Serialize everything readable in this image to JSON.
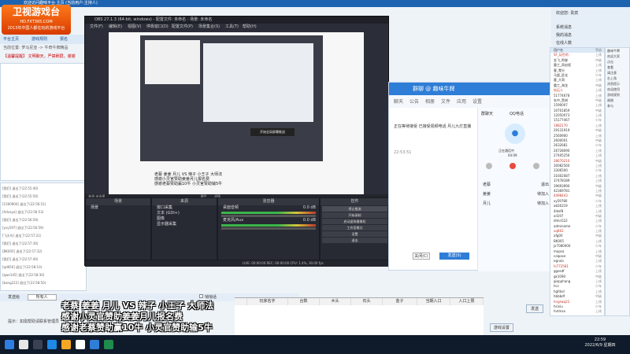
{
  "app": {
    "titlebar": "欢迎访问趣味平台·主页 (当前用户:主持人)",
    "logo_line1": "卫视游戏台",
    "logo_line2": "HD.FXT365.COM",
    "logo_line3": "2013年中国人都在玩的游戏平台",
    "topbar": [
      "平台主页",
      "游戏规则",
      "报名"
    ],
    "breadcrumb": "当前位置: 罗马尼亚 -> 牛奇牛牌精品",
    "notice": "【温馨提醒】 文明聊天，严禁刷屏，谢谢",
    "chatlog": [
      "[我们] 退出了(22:55:40)",
      "[我们] 退出了(22:55:50)",
      "[1560900] 退出了(22:56:51)",
      "[Advaya] 退出了(22:56:53)",
      "[我们] 退出了(22:56:59)",
      "[yxy597] 退出了(22:56:59)",
      "[飞天鸟] 退出了(22:57:21)",
      "[我们] 退出了(22:57:30)",
      "[BK005] 退出了(22:57:32)",
      "[我们] 退出了(22:57:40)",
      "[qd656] 退出了(22:58:10)",
      "[qwe145] 退出了(22:58:30)",
      "[bang222] 退出了(22:58:50)"
    ],
    "send_label": "发送给",
    "send_target": "所有人",
    "checkbox_label": "悄悄话",
    "tips": "提示：如需帮助请联系管理员",
    "send_button": "发送",
    "settings_button": "游戏设置"
  },
  "obs": {
    "title": "OBS 27.1.3 (64-bit, windows) - 配置文件: 未命名 - 场景: 未命名",
    "menu": [
      "文件(F)",
      "编辑(E)",
      "视图(V)",
      "停靠窗口(D)",
      "配置文件(P)",
      "场景集合(S)",
      "工具(T)",
      "帮助(H)"
    ],
    "popup": "开始全局屏幕推送",
    "caption_line1": "老蔡 姜姜 月儿 VS 辣子 小王子 大师法",
    "caption_line2": "感谢小灵官赞助姜姜月儿报名费",
    "caption_line3": "感谢老蔡赞助赢10牛 小灵官赞助输5牛",
    "source_panel_title": "来源 未选择",
    "filter_btn": "属性",
    "filter_btn2": "滤镜",
    "docks": {
      "scenes_title": "场景",
      "scenes": [
        "场景"
      ],
      "sources_title": "来源",
      "sources": [
        "窗口采集",
        "文本 (GDI+)",
        "图像",
        "显示器采集"
      ],
      "mixer_title": "混音器",
      "mixer": [
        {
          "name": "桌面音频",
          "db": "0.0 dB"
        },
        {
          "name": "麦克风/Aux",
          "db": "0.0 dB"
        }
      ],
      "transitions_title": "转场特效",
      "controls_title": "控件",
      "controls": [
        "停止推流",
        "开始录制",
        "启动虚拟摄像机",
        "工作室模式",
        "设置",
        "退出"
      ],
      "transition_name": "渐变"
    },
    "status": "LIVE: 00:00:00  REC: 00:00:00  CPU: 1.4%, 30.00 fps"
  },
  "qq": {
    "title": "群聊 @ 趣味牛牌",
    "tabs": [
      "聊天",
      "公告",
      "相册",
      "文件",
      "应用",
      "设置"
    ],
    "msg1": "正在等待接受 已接受视频电话 月儿九灯直播",
    "time": "22:53:51",
    "side_title": "群聊天",
    "side_sub": "QQ电话",
    "side_btn": "正在通话中",
    "side_dur": "04:09",
    "members": [
      {
        "name": "老蔡",
        "tag": "退出"
      },
      {
        "name": "姜姜",
        "tag": "待加入"
      },
      {
        "name": "月儿",
        "tag": "待加入"
      }
    ],
    "btn_close": "关闭(C)",
    "btn_send": "发送(S)"
  },
  "sidenav": {
    "welcome": "欢迎您: 贵宾",
    "items": [
      "系统消息",
      "我的消息",
      "在线人数"
    ]
  },
  "members_header": [
    "用户名",
    "等级"
  ],
  "members": [
    {
      "name": "SF_玩世的",
      "tag": "上线"
    },
    {
      "name": "金飞_鸣誉",
      "tag": "中级"
    },
    {
      "name": "重工_再启程",
      "tag": "上线"
    },
    {
      "name": "客_零分",
      "tag": "上线"
    },
    {
      "name": "马超_匠化",
      "tag": "少年"
    },
    {
      "name": "客_大哥",
      "tag": "上线"
    },
    {
      "name": "重工_海龙",
      "tag": "中级"
    },
    {
      "name": "钻石人",
      "tag": "上线"
    },
    {
      "name": "51774678",
      "tag": "上线"
    },
    {
      "name": "玄中_黑胡",
      "tag": "中级"
    },
    {
      "name": "1590007",
      "tag": "上线"
    },
    {
      "name": "10701859",
      "tag": "中级"
    },
    {
      "name": "12050073",
      "tag": "上线"
    },
    {
      "name": "15177467",
      "tag": "少年"
    },
    {
      "name": "1882170",
      "tag": "上线"
    },
    {
      "name": "29131919",
      "tag": "中级"
    },
    {
      "name": "2560900",
      "tag": "上线"
    },
    {
      "name": "2600001",
      "tag": "中级"
    },
    {
      "name": "2632681",
      "tag": "少年"
    },
    {
      "name": "26728090",
      "tag": "上线"
    },
    {
      "name": "27405256",
      "tag": "上线"
    },
    {
      "name": "28670210",
      "tag": "中级"
    },
    {
      "name": "30082560",
      "tag": "上线"
    },
    {
      "name": "3306500",
      "tag": "少年"
    },
    {
      "name": "31602087",
      "tag": "上线"
    },
    {
      "name": "37478189",
      "tag": "上线"
    },
    {
      "name": "39693990",
      "tag": "中级"
    },
    {
      "name": "42369781",
      "tag": "上线"
    },
    {
      "name": "4498443",
      "tag": "中级"
    },
    {
      "name": "xy59780",
      "tag": "少年"
    },
    {
      "name": "ab56219",
      "tag": "上线"
    },
    {
      "name": "4ldsf8",
      "tag": "上线"
    },
    {
      "name": "ali197",
      "tag": "中级"
    },
    {
      "name": "dlmn522",
      "tag": "上线"
    },
    {
      "name": "adminame",
      "tag": "少年"
    },
    {
      "name": "xq663",
      "tag": "上线"
    },
    {
      "name": "afg00",
      "tag": "中级"
    },
    {
      "name": "BK005",
      "tag": "上线"
    },
    {
      "name": "Jx7080000",
      "tag": "少年"
    },
    {
      "name": "mapsa",
      "tag": "上线"
    },
    {
      "name": "calpase",
      "tag": "中级"
    },
    {
      "name": "egrula",
      "tag": "上线"
    },
    {
      "name": "hi772581",
      "tag": "少年"
    },
    {
      "name": "ggesdf",
      "tag": "上线"
    },
    {
      "name": "gk1090",
      "tag": "中级"
    },
    {
      "name": "giopphang",
      "tag": "上线"
    },
    {
      "name": "hcc",
      "tag": "少年"
    },
    {
      "name": "hgfdsd",
      "tag": "上线"
    },
    {
      "name": "hbbbdf",
      "tag": "中级"
    },
    {
      "name": "hngrwq22",
      "tag": "上线"
    },
    {
      "name": "hsiviu",
      "tag": "少年"
    },
    {
      "name": "hvtmxx",
      "tag": "上线"
    }
  ],
  "right_col": [
    "趣味牛牌",
    "欢迎大家",
    "点击",
    "查看",
    "请注意",
    "右上角",
    "消息提示",
    "欢迎使用",
    "游戏规则",
    "谢谢",
    "参与"
  ],
  "sheet_headers": [
    "",
    "玩家名字",
    "台数",
    "木头",
    "石头",
    "金子",
    "当期入口",
    "入口上限"
  ],
  "taskbar": {
    "time": "22:59",
    "date": "2022/6/9 星期四"
  },
  "colors": {
    "obs_bg": "#2b2e38",
    "qq_blue": "#2e7dd7",
    "app_blue": "#1e63b0"
  }
}
